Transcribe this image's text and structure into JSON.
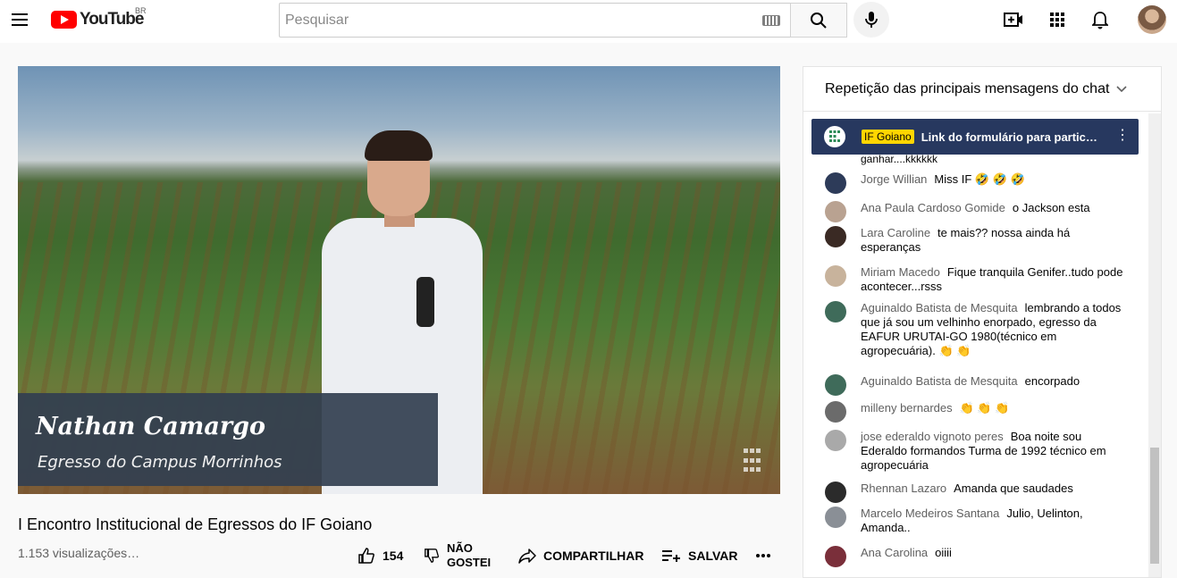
{
  "topbar": {
    "logo_text": "YouTube",
    "region": "BR",
    "search_placeholder": "Pesquisar",
    "icons": [
      "menu-icon",
      "keyboard-icon",
      "search-icon",
      "mic-icon",
      "create-video-icon",
      "apps-grid-icon",
      "bell-icon",
      "avatar"
    ]
  },
  "video": {
    "lower_third_name": "Nathan Camargo",
    "lower_third_subtitle": "Egresso do Campus Morrinhos",
    "title": "I Encontro Institucional de Egressos do IF Goiano",
    "views": "1.153 visualizações…",
    "likes": "154",
    "dislike_label": "NÃO GOSTEI",
    "share_label": "COMPARTILHAR",
    "save_label": "SALVAR"
  },
  "chat": {
    "header": "Repetição das principais mensagens do chat",
    "pinned": {
      "author": "IF Goiano",
      "text": "Link do formulário para participa..."
    },
    "partial_line": "ganhar....kkkkkk",
    "messages": [
      {
        "author": "Jorge Willian",
        "text": "Miss IF 🤣 🤣 🤣",
        "avatar_color": "#2d3b59"
      },
      {
        "author": "Ana Paula Cardoso Gomide",
        "text": "o Jackson esta",
        "avatar_color": "#b9a291"
      },
      {
        "author": "Lara Caroline",
        "text": "te mais?? nossa ainda há esperanças",
        "avatar_color": "#3a2a24"
      },
      {
        "author": "Miriam Macedo",
        "text": "Fique tranquila Genifer..tudo pode acontecer...rsss",
        "avatar_color": "#c8b39c"
      },
      {
        "author": "Aguinaldo Batista de Mesquita",
        "text": "lembrando a todos que já sou um velhinho enorpado, egresso da EAFUR URUTAI-GO 1980(técnico em agropecuária). 👏 👏",
        "avatar_color": "#3f6b5a"
      },
      {
        "author": "Aguinaldo Batista de Mesquita",
        "text": "encorpado",
        "avatar_color": "#3f6b5a"
      },
      {
        "author": "milleny bernardes",
        "text": "👏 👏 👏",
        "avatar_color": "#6b6b6b"
      },
      {
        "author": "jose ederaldo vignoto peres",
        "text": "Boa noite sou Ederaldo formandos Turma de 1992 técnico em agropecuária",
        "avatar_color": "#a9a9a9"
      },
      {
        "author": "Rhennan Lazaro",
        "text": "Amanda que saudades",
        "avatar_color": "#2b2b2b"
      },
      {
        "author": "Marcelo Medeiros Santana",
        "text": "Julio, Uelinton, Amanda..",
        "avatar_color": "#8a8f96"
      },
      {
        "author": "Ana Carolina",
        "text": "oiiii",
        "avatar_color": "#7a2f3a"
      }
    ]
  }
}
